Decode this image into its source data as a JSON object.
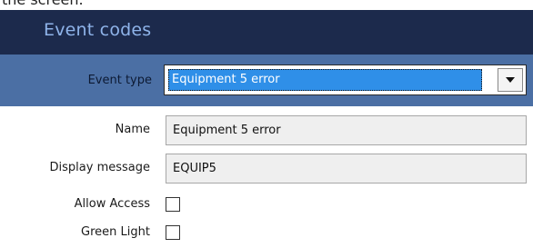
{
  "page_top_text": "the screen.",
  "header": {
    "title": "Event codes"
  },
  "event_type": {
    "label": "Event type",
    "selected": "Equipment 5 error"
  },
  "form": {
    "name": {
      "label": "Name",
      "value": "Equipment 5 error"
    },
    "display_message": {
      "label": "Display message",
      "value": "EQUIP5"
    },
    "allow_access": {
      "label": "Allow Access",
      "checked": false
    },
    "green_light": {
      "label": "Green Light",
      "checked": false
    }
  },
  "colors": {
    "header_bg": "#1c2a4c",
    "event_band_bg": "#4b6fa4",
    "selected_bg": "#2f8fe8"
  }
}
